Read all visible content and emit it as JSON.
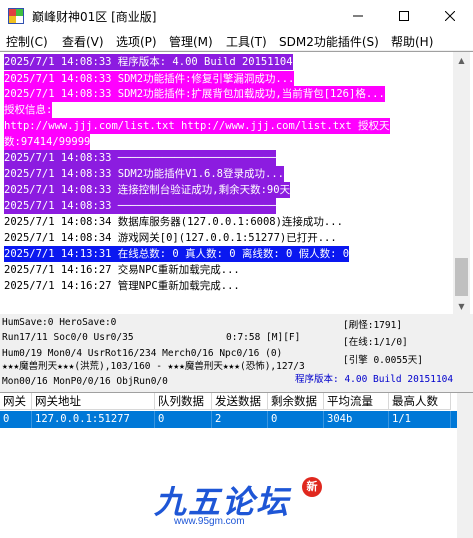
{
  "window": {
    "title": "巅峰财神01区 [商业版]"
  },
  "menu": {
    "items": [
      "控制(C)",
      "查看(V)",
      "选项(P)",
      "管理(M)",
      "工具(T)",
      "SDM2功能插件(S)",
      "帮助(H)"
    ]
  },
  "log": {
    "lines": [
      "2025/7/1 14:08:33 程序版本: 4.00 Build 20151104",
      "2025/7/1 14:08:33 SDM2功能插件:修复引擎漏洞成功...",
      "2025/7/1 14:08:33 SDM2功能插件:扩展背包加载成功,当前背包[126]格...",
      "授权信息:",
      "http://www.jjj.com/list.txt http://www.jjj.com/list.txt 授权天",
      "数:97414/99999",
      "2025/7/1 14:08:33 ─────────────────────────",
      "2025/7/1 14:08:33 SDM2功能插件V1.6.8登录成功...",
      "2025/7/1 14:08:33 连接控制台验证成功,剩余天数:90天",
      "2025/7/1 14:08:33 ─────────────────────────",
      "2025/7/1 14:08:34 数据库服务器(127.0.0.1:6008)连接成功...",
      "2025/7/1 14:08:34 游戏网关[0](127.0.0.1:51277)已打开...",
      "2025/7/1 14:13:31 在线总数: 0 真人数: 0 离线数: 0 假人数: 0",
      "2025/7/1 14:16:27 交易NPC重新加载完成...",
      "2025/7/1 14:16:27 管理NPC重新加载完成..."
    ]
  },
  "status": {
    "line1": "HumSave:0 HeroSave:0",
    "line2_left": "Run17/11 Soc0/0 Usr0/35",
    "line2_mid": "0:7:58 [M][F]",
    "line3": "Hum0/19 Mon0/4 UsrRot16/234 Merch0/16 Npc0/16 (0)",
    "line4": "★★★魔兽刑天★★★(洪荒),103/160 - ★★★魔兽刑天★★★(恐怖),127/3",
    "line5": "Mon00/16 MonP0/0/16 ObjRun0/0",
    "refresh": "[刷怪:1791]",
    "online": "[在线:1/1/0]",
    "lead": "[引擎 0.0055天]",
    "version": "程序版本: 4.00 Build 20151104"
  },
  "table": {
    "headers": [
      "网关",
      "网关地址",
      "队列数据",
      "发送数据",
      "剩余数据",
      "平均流量",
      "最高人数"
    ],
    "rows": [
      [
        "0",
        "127.0.0.1:51277",
        "0",
        "2",
        "0",
        "304b",
        "1/1"
      ]
    ]
  },
  "watermark": {
    "main": "九五论坛",
    "url": "www.95gm.com",
    "badge": "新"
  },
  "colors": {
    "purple": "#8c1ce0",
    "magenta": "#ff00ff",
    "blue": "#0a18f0",
    "selection": "#0078d7",
    "status_blue": "#0000cc"
  }
}
